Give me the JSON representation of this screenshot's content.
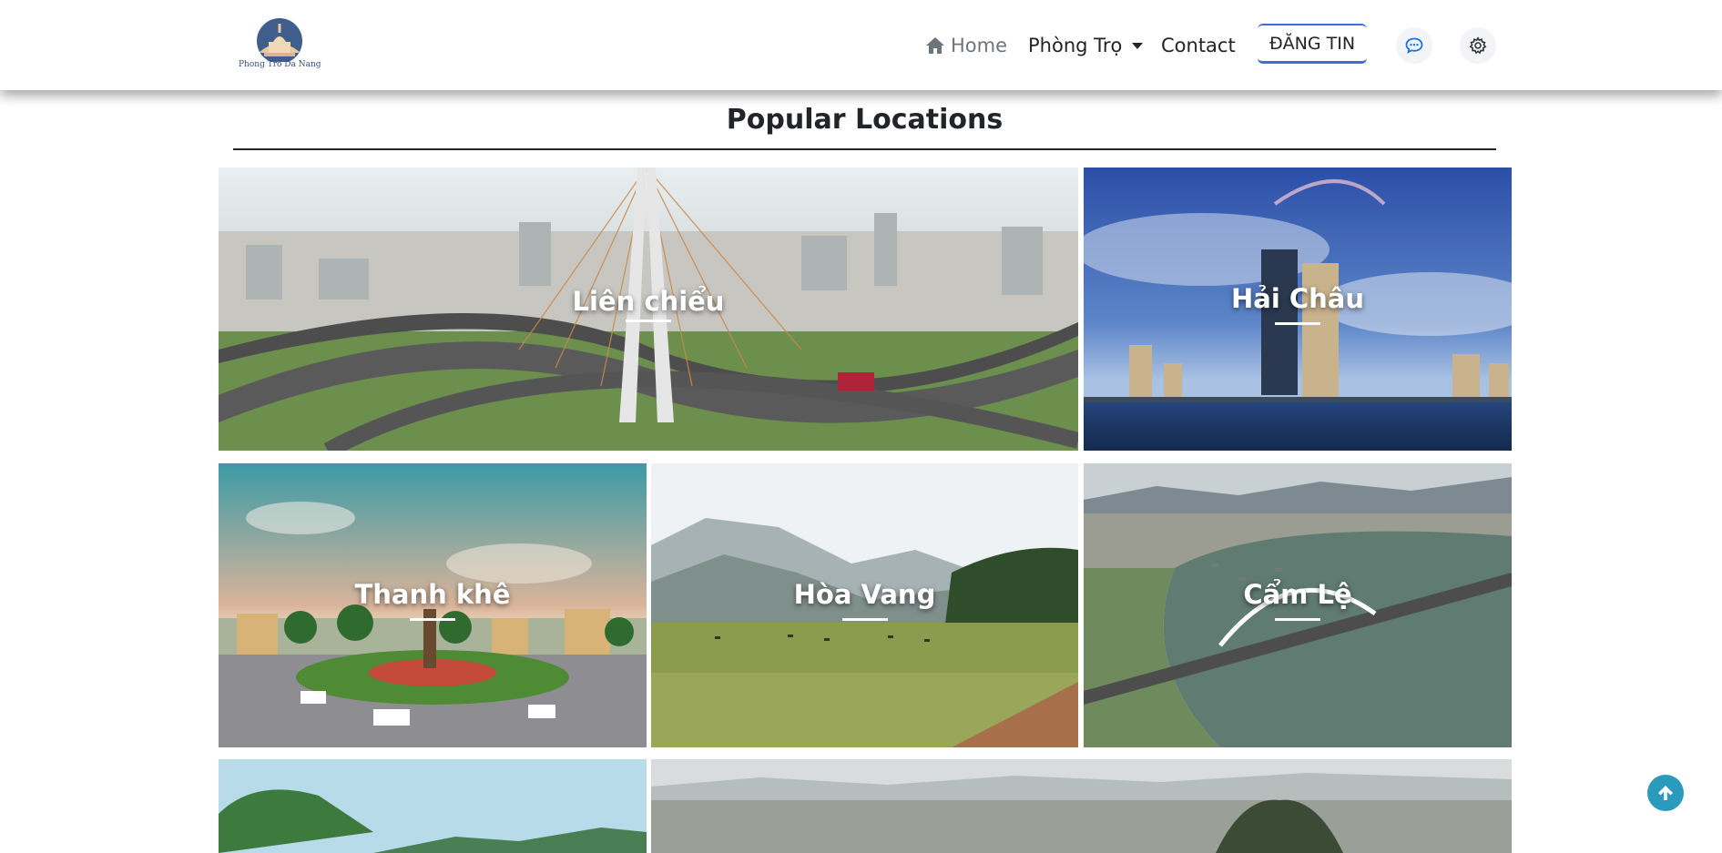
{
  "brand": {
    "name": "Phong Tro Da Nang"
  },
  "nav": {
    "home": "Home",
    "phong_tro": "Phòng Trọ",
    "contact": "Contact",
    "dang_tin": "ĐĂNG TIN"
  },
  "icons": {
    "home": "home-icon",
    "dropdown": "caret-down-icon",
    "chat": "chat-icon",
    "settings": "gear-icon",
    "scroll_top": "arrow-up-icon"
  },
  "colors": {
    "accent_blue": "#3b6fd6",
    "scroll_top_bg": "#2a9bbd",
    "text_dark": "#212529",
    "text_muted": "#6c757d"
  },
  "section": {
    "title": "Popular Locations"
  },
  "locations": [
    {
      "name": "Liên chiểu"
    },
    {
      "name": "Hải Châu"
    },
    {
      "name": "Thanh khê"
    },
    {
      "name": "Hòa Vang"
    },
    {
      "name": "Cẩm Lệ"
    },
    {
      "name": ""
    },
    {
      "name": ""
    }
  ]
}
